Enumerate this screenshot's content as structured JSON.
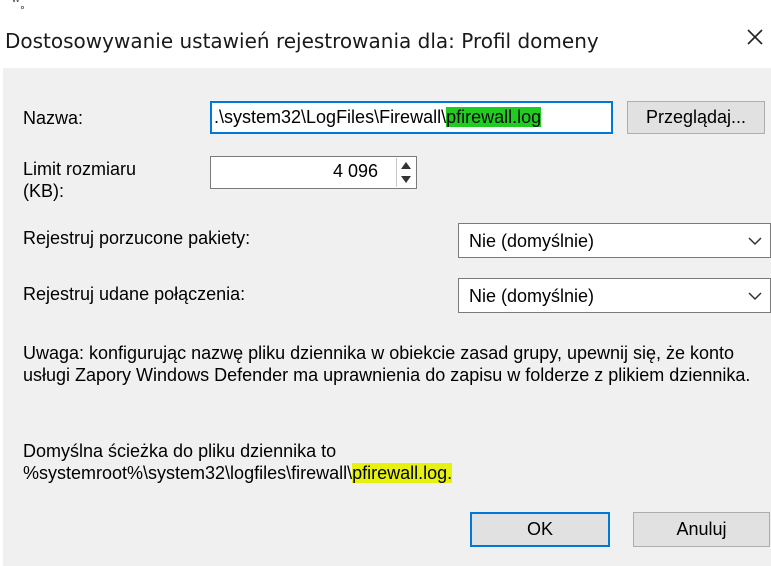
{
  "window": {
    "title": "Dostosowywanie ustawień rejestrowania dla: Profil domeny",
    "close_glyph": "✕"
  },
  "form": {
    "name_label": "Nazwa:",
    "name_value_prefix": ".\\system32\\LogFiles\\Firewall\\",
    "name_value_selected": "pfirewall.log",
    "browse_button": "Przeglądaj...",
    "size_label_line1": "Limit rozmiaru",
    "size_label_line2": "(KB):",
    "size_value": "4 096",
    "dropped_label": "Rejestruj porzucone pakiety:",
    "dropped_value": "Nie (domyślnie)",
    "success_label": "Rejestruj udane połączenia:",
    "success_value": "Nie (domyślnie)"
  },
  "notes": {
    "warning": "Uwaga: konfigurując nazwę pliku dziennika w obiekcie zasad grupy, upewnij się, że konto usługi Zapory Windows Defender ma uprawnienia do zapisu w folderze z plikiem dziennika.",
    "default_path_line1": "Domyślna ścieżka do pliku dziennika to",
    "default_path_prefix": "%systemroot%\\system32\\logfiles\\firewall\\",
    "default_path_highlight": "pfirewall.log."
  },
  "buttons": {
    "ok": "OK",
    "cancel": "Anuluj"
  },
  "colors": {
    "accent": "#0078d7",
    "highlight": "#e6f20d",
    "selection": "#20cc20",
    "panel_bg": "#f0f0f0"
  }
}
